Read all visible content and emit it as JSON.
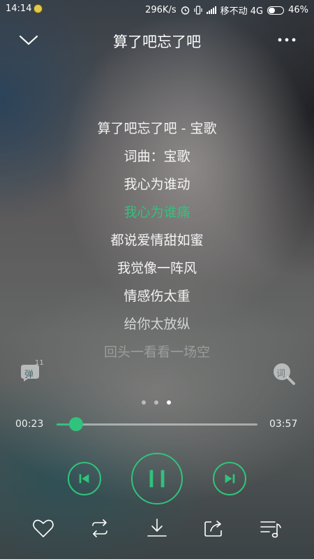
{
  "status_bar": {
    "time": "14:14",
    "network_speed": "296K/s",
    "carrier": "移不动 4G",
    "battery": "46%"
  },
  "header": {
    "title": "算了吧忘了吧"
  },
  "lyrics": [
    "算了吧忘了吧 - 宝歌",
    "词曲：宝歌",
    "我心为谁动",
    "我心为谁痛",
    "都说爱情甜如蜜",
    "我觉像一阵风",
    "情感伤太重",
    "给你太放纵",
    "回头一看看一场空"
  ],
  "active_lyric_index": 3,
  "side": {
    "danmu_label": "弹",
    "danmu_count": "11",
    "lyrics_search_label": "词"
  },
  "pager": {
    "count": 3,
    "active": 2
  },
  "progress": {
    "current": "00:23",
    "total": "03:57",
    "fraction": 0.097
  },
  "colors": {
    "accent": "#31c27c"
  },
  "icons": {
    "back": "chevron-down-icon",
    "more": "more-icon",
    "prev": "previous-icon",
    "pause": "pause-icon",
    "next": "next-icon",
    "like": "heart-icon",
    "mode": "repeat-icon",
    "download": "download-icon",
    "share": "share-icon",
    "playlist": "playlist-icon"
  }
}
